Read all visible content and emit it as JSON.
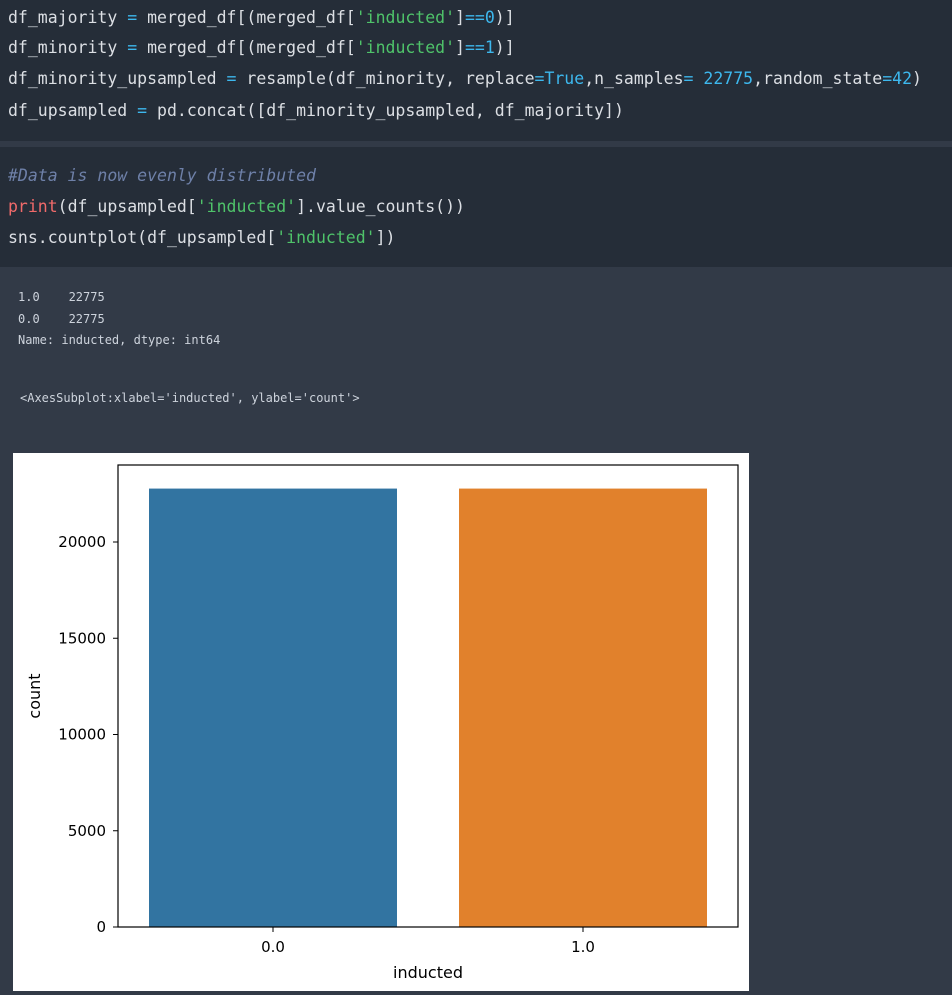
{
  "cell1": {
    "lines": [
      {
        "parts": [
          {
            "t": "df_majority ",
            "c": ""
          },
          {
            "t": "=",
            "c": "kw-eq"
          },
          {
            "t": " merged_df[(merged_df[",
            "c": ""
          },
          {
            "t": "'inducted'",
            "c": "str"
          },
          {
            "t": "]",
            "c": ""
          },
          {
            "t": "==",
            "c": "kw-eq"
          },
          {
            "t": "0",
            "c": "num"
          },
          {
            "t": ")]",
            "c": ""
          }
        ]
      },
      {
        "parts": [
          {
            "t": "df_minority ",
            "c": ""
          },
          {
            "t": "=",
            "c": "kw-eq"
          },
          {
            "t": " merged_df[(merged_df[",
            "c": ""
          },
          {
            "t": "'inducted'",
            "c": "str"
          },
          {
            "t": "]",
            "c": ""
          },
          {
            "t": "==",
            "c": "kw-eq"
          },
          {
            "t": "1",
            "c": "num"
          },
          {
            "t": ")]",
            "c": ""
          }
        ]
      },
      {
        "parts": [
          {
            "t": "df_minority_upsampled ",
            "c": ""
          },
          {
            "t": "=",
            "c": "kw-eq"
          },
          {
            "t": " resample(df_minority, replace",
            "c": ""
          },
          {
            "t": "=",
            "c": "kw-eq"
          },
          {
            "t": "True",
            "c": "bool"
          },
          {
            "t": ",n_samples",
            "c": ""
          },
          {
            "t": "=",
            "c": "kw-eq"
          },
          {
            "t": " ",
            "c": ""
          },
          {
            "t": "22775",
            "c": "num"
          },
          {
            "t": ",random_state",
            "c": ""
          },
          {
            "t": "=",
            "c": "kw-eq"
          },
          {
            "t": "42",
            "c": "num"
          },
          {
            "t": ")",
            "c": ""
          }
        ]
      },
      {
        "parts": [
          {
            "t": "df_upsampled ",
            "c": ""
          },
          {
            "t": "=",
            "c": "kw-eq"
          },
          {
            "t": " pd.concat([df_minority_upsampled, df_majority])",
            "c": ""
          }
        ]
      }
    ]
  },
  "cell2": {
    "lines": [
      {
        "parts": [
          {
            "t": "#Data is now evenly distributed",
            "c": "comment"
          }
        ]
      },
      {
        "parts": [
          {
            "t": "print",
            "c": "builtin"
          },
          {
            "t": "(df_upsampled[",
            "c": ""
          },
          {
            "t": "'inducted'",
            "c": "str"
          },
          {
            "t": "].value_counts())",
            "c": ""
          }
        ]
      },
      {
        "parts": [
          {
            "t": "sns.countplot(df_upsampled[",
            "c": ""
          },
          {
            "t": "'inducted'",
            "c": "str"
          },
          {
            "t": "])",
            "c": ""
          }
        ]
      }
    ]
  },
  "output": {
    "stdout": [
      "1.0    22775",
      "0.0    22775",
      "Name: inducted, dtype: int64"
    ],
    "repr": "<AxesSubplot:xlabel='inducted', ylabel='count'>"
  },
  "chart_data": {
    "type": "bar",
    "categories": [
      "0.0",
      "1.0"
    ],
    "values": [
      22775,
      22775
    ],
    "colors": [
      "#3274a1",
      "#e1812c"
    ],
    "xlabel": "inducted",
    "ylabel": "count",
    "ylim": [
      0,
      24000
    ],
    "yticks": [
      0,
      5000,
      10000,
      15000,
      20000
    ],
    "grid": false
  }
}
